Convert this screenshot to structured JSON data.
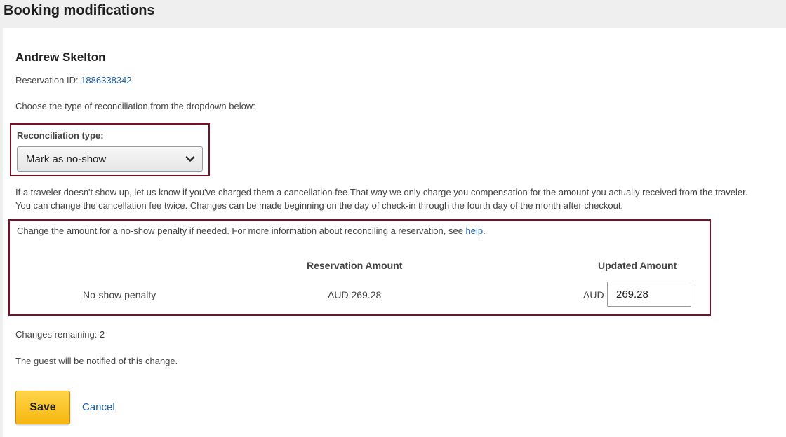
{
  "page": {
    "title": "Booking modifications"
  },
  "booking": {
    "guest_name": "Andrew Skelton",
    "reservation_id_label": "Reservation ID: ",
    "reservation_id": "1886338342",
    "instruction": "Choose the type of reconciliation from the dropdown below:"
  },
  "reconciliation": {
    "label": "Reconciliation type:",
    "selected": "Mark as no-show",
    "info_line1": "If a traveler doesn't show up, let us know if you've charged them a cancellation fee.That way we only charge you compensation for the amount you actually received from the traveler.",
    "info_line2": "You can change the cancellation fee twice. Changes can be made beginning on the day of check-in through the fourth day of the month after checkout."
  },
  "amounts": {
    "description": "Change the amount for a no-show penalty if needed. For more information about reconciling a reservation, see ",
    "help_link": "help",
    "description_end": ".",
    "col_reservation": "Reservation Amount",
    "col_updated": "Updated Amount",
    "row_label": "No-show penalty",
    "reservation_amount": "AUD 269.28",
    "currency": "AUD",
    "updated_amount": "269.28"
  },
  "status": {
    "changes_remaining": "Changes remaining: 2",
    "notify": "The guest will be notified of this change."
  },
  "actions": {
    "save": "Save",
    "cancel": "Cancel"
  },
  "colors": {
    "highlight_border": "#7a1127",
    "link": "#1a5ea8",
    "save_button": "#f5b70f"
  },
  "icons": {
    "dropdown": "chevron-down-icon"
  }
}
